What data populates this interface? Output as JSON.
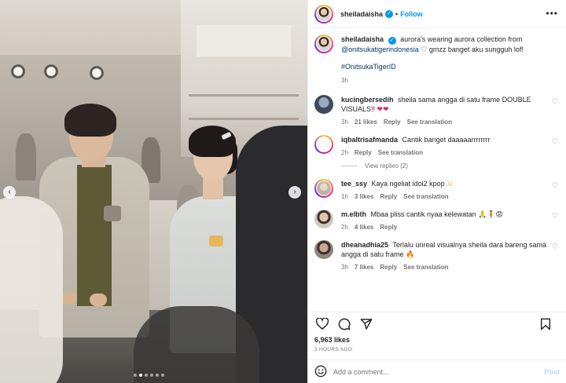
{
  "header": {
    "username": "sheiladaisha",
    "separator": "•",
    "follow_label": "Follow",
    "more_icon": "more-icon"
  },
  "caption": {
    "username": "sheiladaisha",
    "text_part1": "aurora's wearing aurora collection from",
    "mention": "@onitsukatigerindonesia",
    "text_part2": "gmzz banget aku sungguh lof!",
    "hashtag": "#OnitsukaTigerID",
    "time": "3h"
  },
  "comments": [
    {
      "username": "kucingbersedih",
      "text": "sheila sama angga di satu frame DOUBLE VISUALS!!",
      "emoji": "❤❤",
      "time": "3h",
      "likes": "21 likes",
      "reply": "Reply",
      "translate": "See translation"
    },
    {
      "username": "iqbaltrisafmanda",
      "text": "Cantik banget daaaaarrrrrrrr",
      "emoji": "",
      "time": "2h",
      "likes": "",
      "reply": "Reply",
      "translate": "See translation",
      "view_replies": "View replies (2)"
    },
    {
      "username": "tee_ssy",
      "text": "Kaya ngeliat idol2 kpop",
      "emoji": "☺",
      "time": "1h",
      "likes": "3 likes",
      "reply": "Reply",
      "translate": "See translation"
    },
    {
      "username": "m.elbth",
      "text": "Mbaa pliss cantik nyaa kelewatan",
      "emoji": "🙏🧍😡",
      "time": "2h",
      "likes": "4 likes",
      "reply": "Reply",
      "translate": ""
    },
    {
      "username": "dheanadhia25",
      "text": "Terlalu unreal visualnya sheila dara bareng sama angga di satu frame",
      "emoji": "🔥",
      "time": "3h",
      "likes": "7 likes",
      "reply": "Reply",
      "translate": "See translation"
    }
  ],
  "footer": {
    "likes": "6,963 likes",
    "ago": "3 HOURS AGO",
    "add_placeholder": "Add a comment...",
    "post_label": "Post"
  },
  "carousel": {
    "slides": 6,
    "active": 1
  },
  "colors": {
    "accent": "#0095f6",
    "text": "#262626",
    "muted": "#737373",
    "post_disabled": "#b3dbff"
  }
}
